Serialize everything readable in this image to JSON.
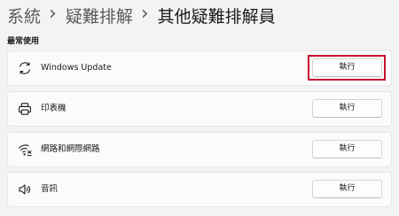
{
  "breadcrumb": {
    "items": [
      "系統",
      "疑難排解",
      "其他疑難排解員"
    ],
    "separator": "›"
  },
  "section_title": "最常使用",
  "troubleshooters": [
    {
      "label": "Windows Update",
      "icon": "refresh-icon",
      "button_label": "執行",
      "highlighted": true
    },
    {
      "label": "印表機",
      "icon": "printer-icon",
      "button_label": "執行",
      "highlighted": false
    },
    {
      "label": "網路和網際網路",
      "icon": "wifi-icon",
      "button_label": "執行",
      "highlighted": false
    },
    {
      "label": "音訊",
      "icon": "speaker-icon",
      "button_label": "執行",
      "highlighted": false
    }
  ],
  "colors": {
    "background": "#f3f3f3",
    "card": "#fbfbfb",
    "highlight": "#c8102e"
  }
}
